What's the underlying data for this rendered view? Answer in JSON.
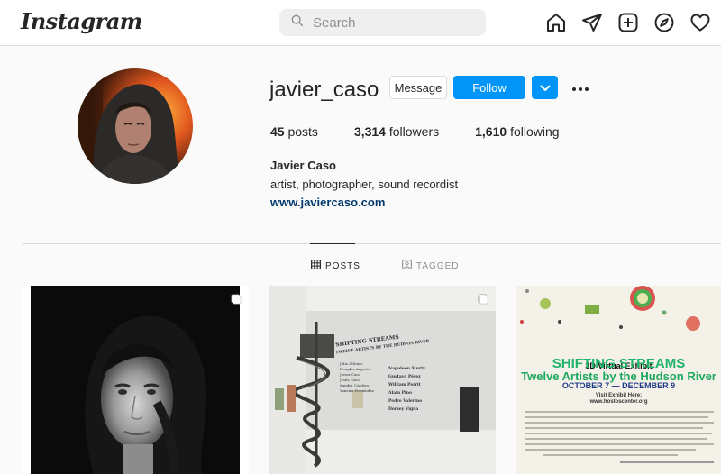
{
  "topbar": {
    "logo": "Instagram",
    "search_placeholder": "Search",
    "icons": [
      "home-icon",
      "send-icon",
      "new-post-icon",
      "explore-icon",
      "heart-icon"
    ]
  },
  "profile": {
    "username": "javier_caso",
    "message_label": "Message",
    "follow_label": "Follow",
    "stats": {
      "posts_count": "45",
      "posts_label": "posts",
      "followers_count": "3,314",
      "followers_label": "followers",
      "following_count": "1,610",
      "following_label": "following"
    },
    "full_name": "Javier Caso",
    "bio": "artist, photographer, sound recordist",
    "website": "www.javiercaso.com"
  },
  "tabs": [
    {
      "label": "POSTS",
      "active": true
    },
    {
      "label": "TAGGED",
      "active": false
    }
  ],
  "posts": {
    "post2": {
      "wall_title": "SHIFTING STREAMS",
      "wall_subtitle": "TWELVE ARTISTS BY THE HUDSON RIVER",
      "artists_left": [
        "Julio Alfonso",
        "Douglas Argueta",
        "Javier Caso",
        "Jesús Caso",
        "Sandra Cordero",
        "Yaneira Fernández"
      ],
      "artists_right": [
        "Napoleón Murty",
        "Gustavo Pérez",
        "William Perrit",
        "Alain Pino",
        "Pedro Valerino",
        "Dorsey Vigna"
      ]
    },
    "post3": {
      "subtitle": "3D Virtual Exhibit",
      "title": "SHIFTING STREAMS",
      "title2": "Twelve Artists by the Hudson River",
      "dates": "OCTOBER 7 — DECEMBER 9",
      "visit": "Visit Exhibit Here:",
      "visit_url": "www.hostoscenter.org"
    }
  },
  "colors": {
    "accent": "#0095f6",
    "link": "#00376b",
    "border": "#dbdbdb",
    "background": "#fafafa"
  }
}
